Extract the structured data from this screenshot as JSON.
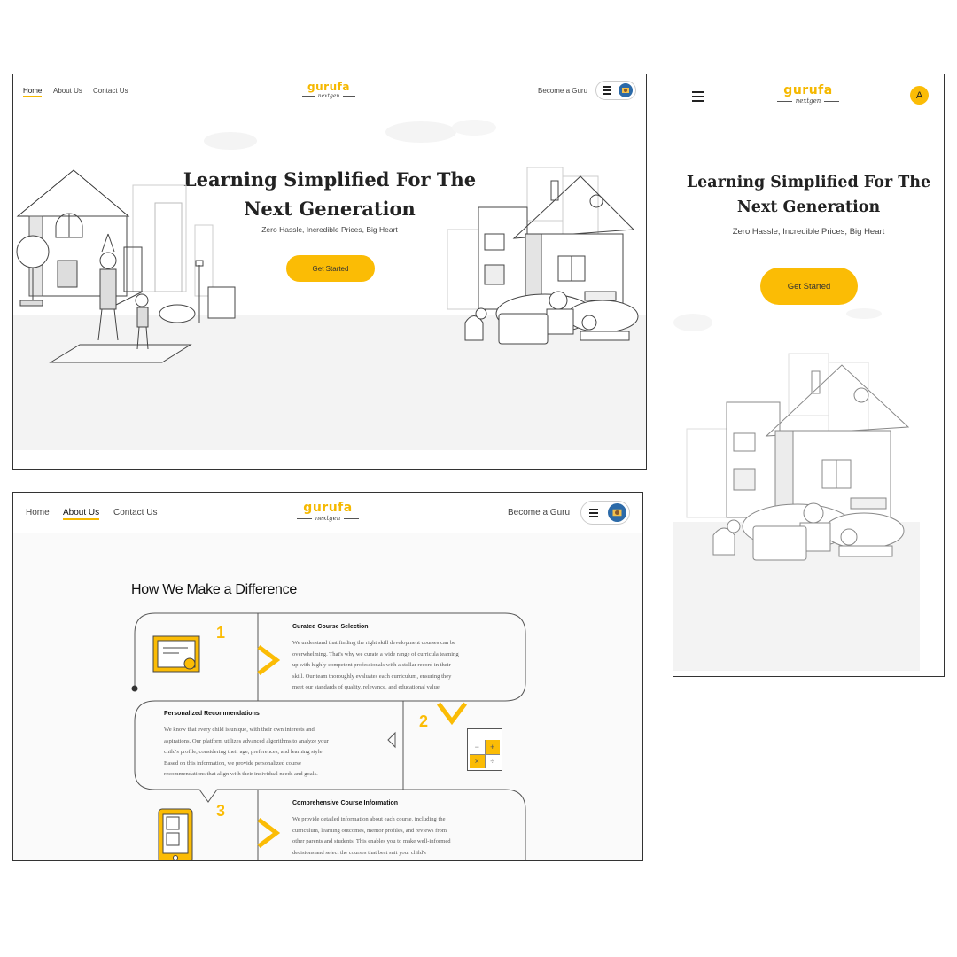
{
  "desktop_home": {
    "nav": {
      "home": "Home",
      "about": "About Us",
      "contact": "Contact Us",
      "become_guru": "Become a Guru"
    },
    "logo": {
      "word": "gurufa",
      "tagline": "nextgen"
    },
    "hero": {
      "title_line1": "Learning Simplified For The",
      "title_line2": "Next Generation",
      "subtitle": "Zero Hassle, Incredible Prices, Big Heart",
      "cta": "Get Started"
    }
  },
  "desktop_about": {
    "nav": {
      "home": "Home",
      "about": "About Us",
      "contact": "Contact Us",
      "become_guru": "Become a Guru"
    },
    "logo": {
      "word": "gurufa",
      "tagline": "nextgen"
    },
    "section_title": "How We Make a Difference",
    "steps": [
      {
        "number": "1",
        "title": "Curated Course Selection",
        "lines": [
          "We understand that finding the right skill development courses can be",
          "overwhelming. That's why we curate a wide range of curricula teaming",
          "up with highly competent professionals with a stellar record in their",
          "skill. Our team thoroughly evaluates each curriculum, ensuring they",
          "meet our standards of quality, relevance, and educational value."
        ]
      },
      {
        "number": "2",
        "title": "Personalized Recommendations",
        "lines": [
          "We know that every child is unique, with their own interests and",
          "aspirations. Our platform utilizes advanced algorithms to analyze your",
          "child's profile, considering their age, preferences, and learning style.",
          "Based on this information, we provide personalized course",
          "recommendations that align with their individual needs and goals."
        ]
      },
      {
        "number": "3",
        "title": "Comprehensive Course Information",
        "lines": [
          "We provide detailed information about each course, including the",
          "curriculum, learning outcomes, mentor profiles, and reviews from",
          "other parents and students. This enables you to make well-informed",
          "decisions and select the courses that best suit your child's"
        ]
      }
    ],
    "calculator_symbols": [
      "−",
      "+",
      "×",
      "÷"
    ]
  },
  "mobile_home": {
    "logo": {
      "word": "gurufa",
      "tagline": "nextgen"
    },
    "profile_initial": "A",
    "hero": {
      "title_line1": "Learning Simplified For The",
      "title_line2": "Next Generation",
      "subtitle": "Zero Hassle, Incredible Prices, Big Heart",
      "cta": "Get Started"
    }
  },
  "colors": {
    "accent": "#fbbc05",
    "accent_dark": "#f5b800",
    "text": "#222222",
    "ground": "#f3f3f3"
  },
  "icons": [
    "hamburger-menu-icon",
    "avatar-icon",
    "certificate-icon",
    "calculator-icon",
    "tablet-icon",
    "chevron-right-icon",
    "chevron-down-icon"
  ]
}
